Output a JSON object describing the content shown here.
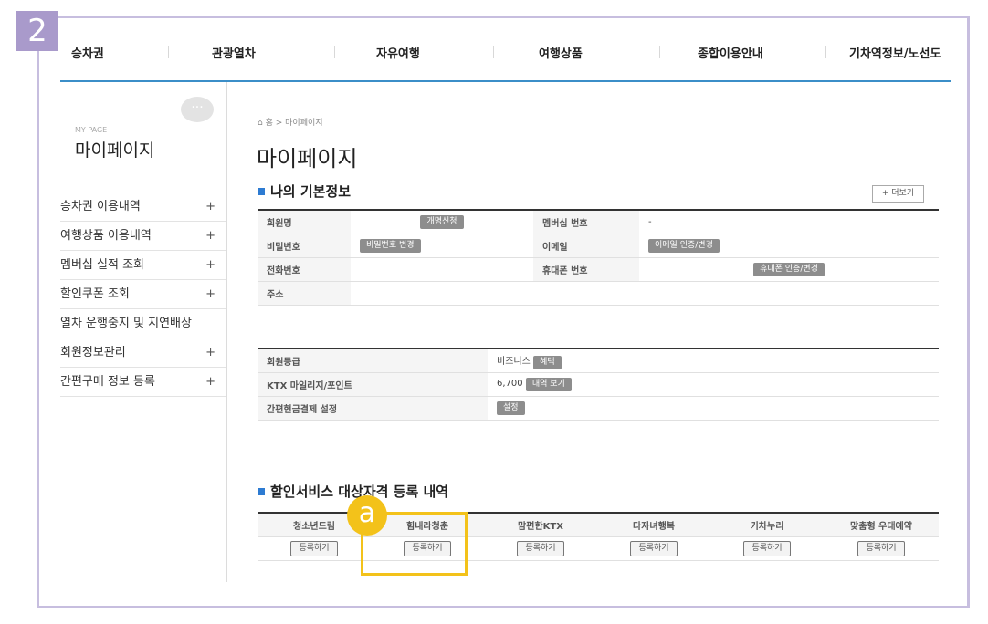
{
  "step_number": "2",
  "annotation_marker": "a",
  "topnav": [
    {
      "label": "승차권"
    },
    {
      "label": "관광열차"
    },
    {
      "label": "자유여행"
    },
    {
      "label": "여행상품"
    },
    {
      "label": "종합이용안내"
    },
    {
      "label": "기차역정보/노선도"
    }
  ],
  "sidebar": {
    "small_title": "MY PAGE",
    "title": "마이페이지",
    "bubble_icon": "···",
    "items": [
      {
        "label": "승차권 이용내역",
        "expand": "+"
      },
      {
        "label": "여행상품 이용내역",
        "expand": "+"
      },
      {
        "label": "멤버십 실적 조회",
        "expand": "+"
      },
      {
        "label": "할인쿠폰 조회",
        "expand": "+"
      },
      {
        "label": "열차 운행중지 및 지연배상",
        "expand": ""
      },
      {
        "label": "회원정보관리",
        "expand": "+"
      },
      {
        "label": "간편구매 정보 등록",
        "expand": "+"
      }
    ]
  },
  "breadcrumb": {
    "home_icon": "⌂",
    "text": "홈 > 마이페이지"
  },
  "page_title": "마이페이지",
  "basic_info": {
    "title": "나의 기본정보",
    "more_label": "+ 더보기",
    "name_label": "회원명",
    "name_btn": "개명신청",
    "membership_label": "멤버십 번호",
    "membership_value": "-",
    "password_label": "비밀번호",
    "password_btn": "비밀번호 변경",
    "email_label": "이메일",
    "email_btn": "이메일 인증/변경",
    "phone_label": "전화번호",
    "mobile_label": "휴대폰 번호",
    "mobile_btn": "휴대폰 인증/변경",
    "address_label": "주소"
  },
  "grade_info": {
    "grade_label": "회원등급",
    "grade_value": "비즈니스",
    "grade_btn": "혜택",
    "mileage_label": "KTX 마일리지/포인트",
    "mileage_value": "6,700",
    "mileage_btn": "내역 보기",
    "cash_label": "간편현금결제 설정",
    "cash_btn": "설정"
  },
  "discount": {
    "title": "할인서비스 대상자격 등록 내역",
    "columns": [
      "청소년드림",
      "힘내라청춘",
      "맘편한KTX",
      "다자녀행복",
      "기차누리",
      "맞춤형 우대예약"
    ],
    "register_label": "등록하기"
  }
}
